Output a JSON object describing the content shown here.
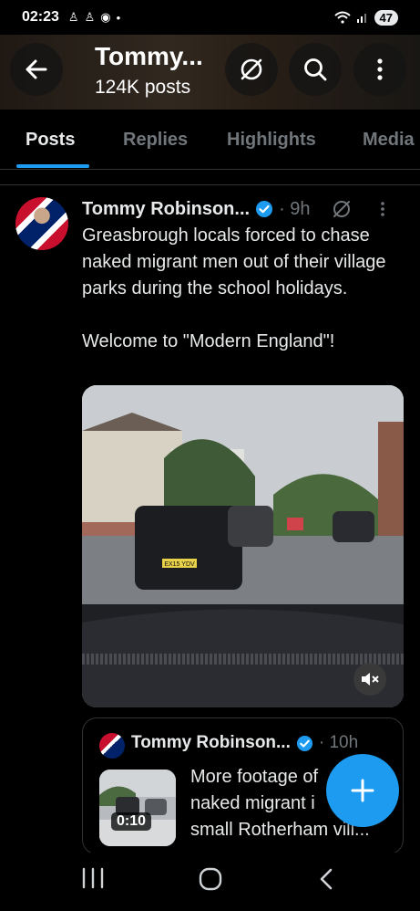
{
  "status_bar": {
    "time": "02:23",
    "battery": "47"
  },
  "header": {
    "title": "Tommy...",
    "subtitle": "124K posts"
  },
  "tabs": [
    {
      "label": "Posts",
      "active": true
    },
    {
      "label": "Replies",
      "active": false
    },
    {
      "label": "Highlights",
      "active": false
    },
    {
      "label": "Media",
      "active": false
    }
  ],
  "post": {
    "author": "Tommy Robinson...",
    "time": "· 9h",
    "text": "Greasbrough locals forced to chase naked migrant men out of their village parks during the school holidays.\n\nWelcome to \"Modern England\"!",
    "media": {
      "plate": "EX15 YDV"
    }
  },
  "quote": {
    "author": "Tommy Robinson...",
    "time": "· 10h",
    "duration": "0:10",
    "text": "More footage of\nnaked migrant i\nsmall Rotherham vill..."
  },
  "colors": {
    "accent": "#1d9bf0",
    "background": "#000000",
    "muted": "#71767b"
  }
}
